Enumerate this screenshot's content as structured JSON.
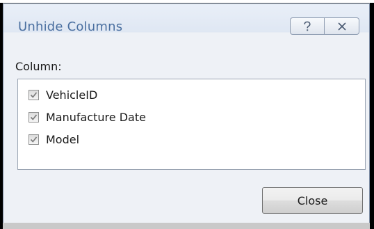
{
  "dialog": {
    "title": "Unhide Columns",
    "help_icon": "question-mark-icon",
    "close_icon": "close-x-icon"
  },
  "column_label": "Column:",
  "columns": [
    {
      "label": "VehicleID",
      "checked": true
    },
    {
      "label": "Manufacture Date",
      "checked": true
    },
    {
      "label": "Model",
      "checked": true
    }
  ],
  "buttons": {
    "close_label": "Close"
  },
  "colors": {
    "title_text": "#4a6fa0",
    "dialog_background": "#eef1f6",
    "list_background": "#ffffff"
  }
}
